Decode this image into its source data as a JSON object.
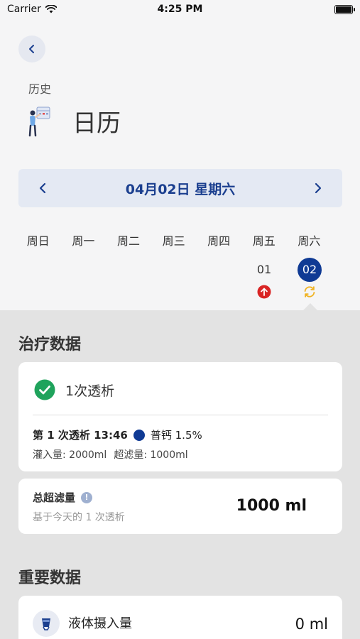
{
  "status_bar": {
    "carrier": "Carrier",
    "time": "4:25 PM"
  },
  "header": {
    "subtitle": "历史",
    "title": "日历",
    "title_icon": "calendar-person-illustration-icon",
    "back_icon": "chevron-left-icon"
  },
  "date_nav": {
    "current_date": "04月02日 星期六",
    "prev_icon": "chevron-left-icon",
    "next_icon": "chevron-right-icon"
  },
  "calendar": {
    "weekdays": [
      "周日",
      "周一",
      "周二",
      "周三",
      "周四",
      "周五",
      "周六"
    ],
    "days": [
      {
        "number": "01",
        "weekday_index": 5,
        "marker": "red-arrow-up-icon",
        "selected": false
      },
      {
        "number": "02",
        "weekday_index": 6,
        "marker": "yellow-sync-icon",
        "selected": true
      }
    ]
  },
  "treatment": {
    "section_title": "治疗数据",
    "summary_label": "1次透析",
    "summary_icon": "green-check-circle-icon",
    "session_label": "第 1 次透析 13:46",
    "solution_name": "普钙 1.5%",
    "solution_color": "#0f3a94",
    "fill_volume": "灌入量: 2000ml",
    "uf_volume": "超滤量: 1000ml"
  },
  "total_uf": {
    "label": "总超滤量",
    "info_icon": "info-circle-icon",
    "info_glyph": "!",
    "hint": "基于今天的 1 次透析",
    "value": "1000 ml"
  },
  "important": {
    "section_title": "重要数据",
    "fluid_label": "液体摄入量",
    "fluid_icon": "cup-icon",
    "fluid_value": "0 ml"
  },
  "colors": {
    "accent": "#0f3a94",
    "date_nav_bg": "#e4e9f3",
    "success": "#1fa35c",
    "warning": "#f0b323",
    "danger": "#d92424"
  }
}
